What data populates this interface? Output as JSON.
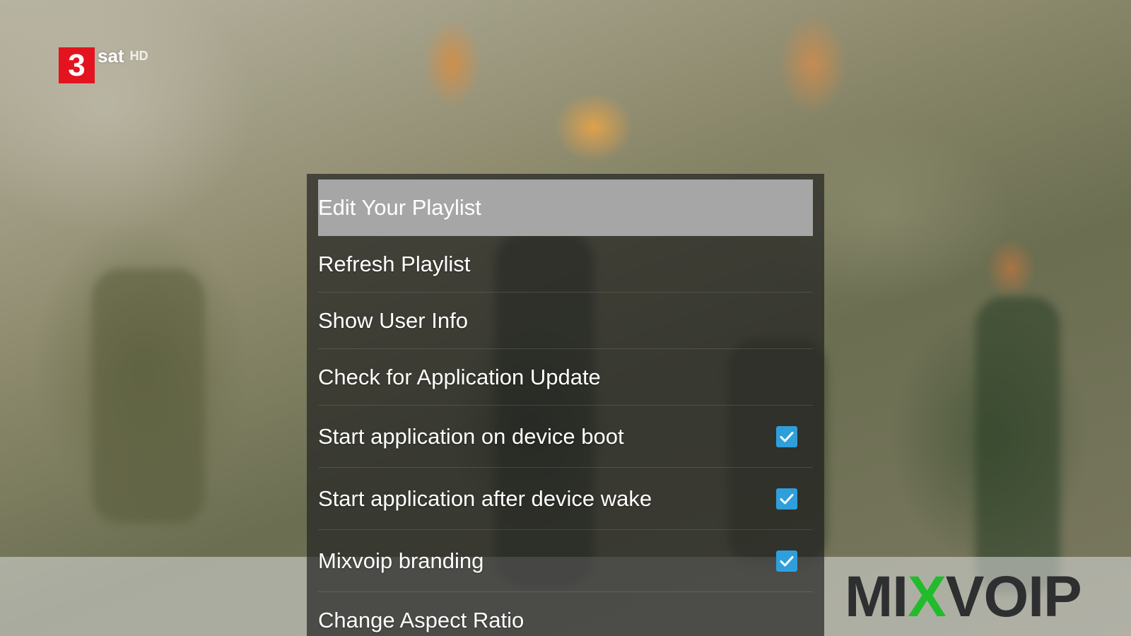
{
  "channel": {
    "number": "3",
    "name": "sat",
    "quality": "HD"
  },
  "menu": {
    "items": [
      {
        "label": "Edit Your Playlist",
        "selected": true
      },
      {
        "label": "Refresh Playlist"
      },
      {
        "label": "Show User Info"
      },
      {
        "label": "Check for Application Update"
      },
      {
        "label": "Start application on device boot",
        "checked": true,
        "icon": "checkbox-checked-icon"
      },
      {
        "label": "Start application after device wake",
        "checked": true,
        "icon": "checkbox-checked-icon"
      },
      {
        "label": "Mixvoip branding",
        "checked": true,
        "icon": "checkbox-checked-icon"
      },
      {
        "label": "Change Aspect Ratio"
      }
    ]
  },
  "brand": {
    "part1": "MI",
    "part2": "X",
    "part3": "VOIP"
  },
  "colors": {
    "channel_red": "#e3131f",
    "checkbox_blue": "#2f9fdc",
    "selection_grey": "#a6a6a6",
    "brand_green": "#22bb2c",
    "brand_dark": "#2e2f30"
  }
}
